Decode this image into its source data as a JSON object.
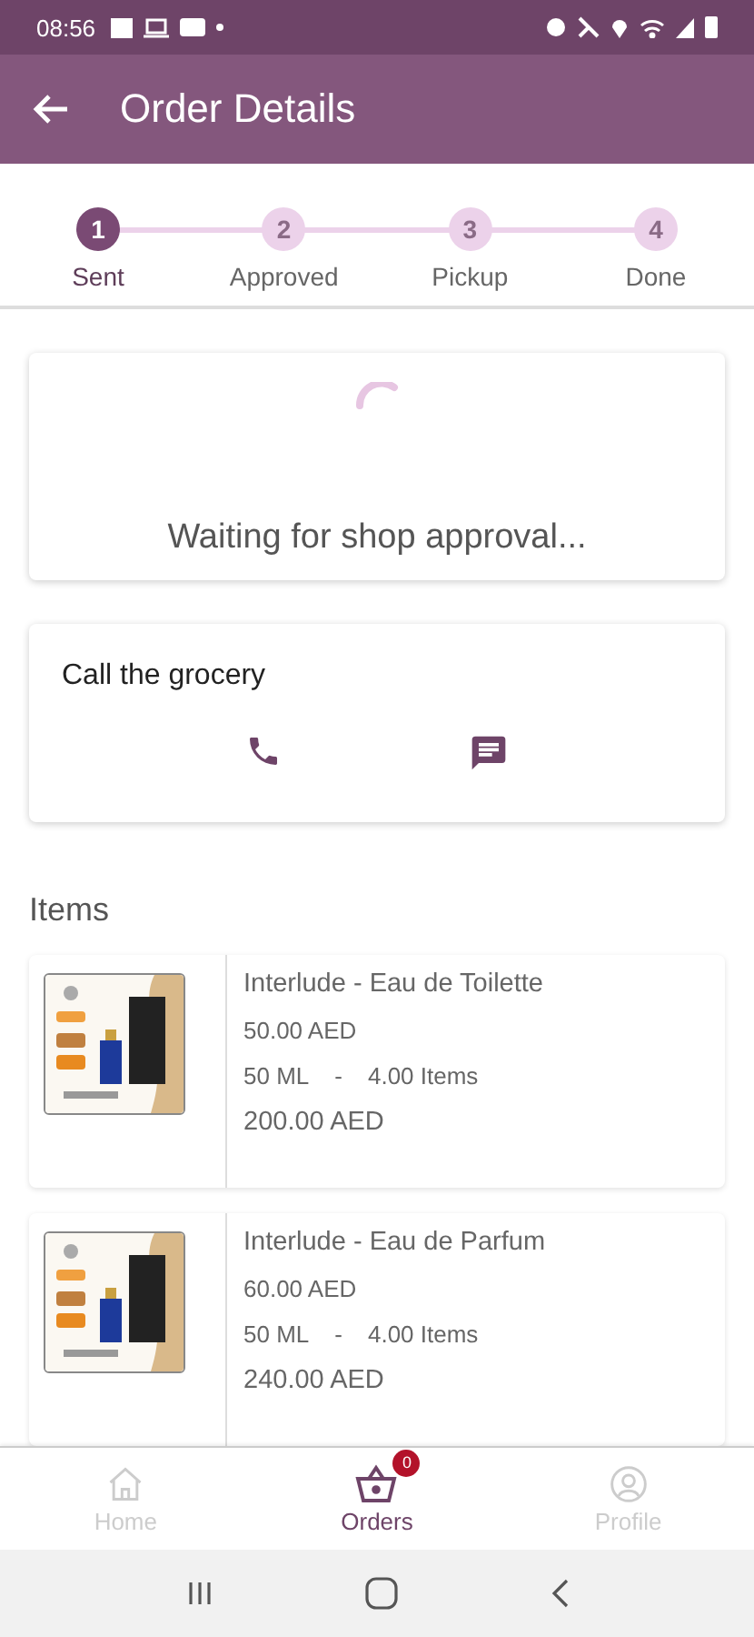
{
  "status_bar": {
    "time": "08:56"
  },
  "app_bar": {
    "title": "Order Details"
  },
  "steps": [
    {
      "number": "1",
      "label": "Sent",
      "selected": true
    },
    {
      "number": "2",
      "label": "Approved",
      "selected": false
    },
    {
      "number": "3",
      "label": "Pickup",
      "selected": false
    },
    {
      "number": "4",
      "label": "Done",
      "selected": false
    }
  ],
  "status_card": {
    "message": "Waiting for shop approval..."
  },
  "contact_card": {
    "title": "Call the grocery"
  },
  "items_heading": "Items",
  "items": [
    {
      "kind": "picture",
      "name": "Interlude - Eau de Toilette",
      "price": "50.00 AED",
      "size": "50 ML",
      "separator": "-",
      "quantity": "4.00 Items",
      "total": "200.00 AED"
    },
    {
      "kind": "picture",
      "name": "Interlude - Eau de Parfum",
      "price": "60.00 AED",
      "size": "50 ML",
      "separator": "-",
      "quantity": "4.00 Items",
      "total": "240.00 AED"
    }
  ],
  "bottom_nav": [
    {
      "kind": "home",
      "label": "Home",
      "selected": false
    },
    {
      "kind": "basket",
      "label": "Orders",
      "selected": true,
      "badge": "0"
    },
    {
      "kind": "profile",
      "label": "Profile",
      "selected": false
    }
  ]
}
